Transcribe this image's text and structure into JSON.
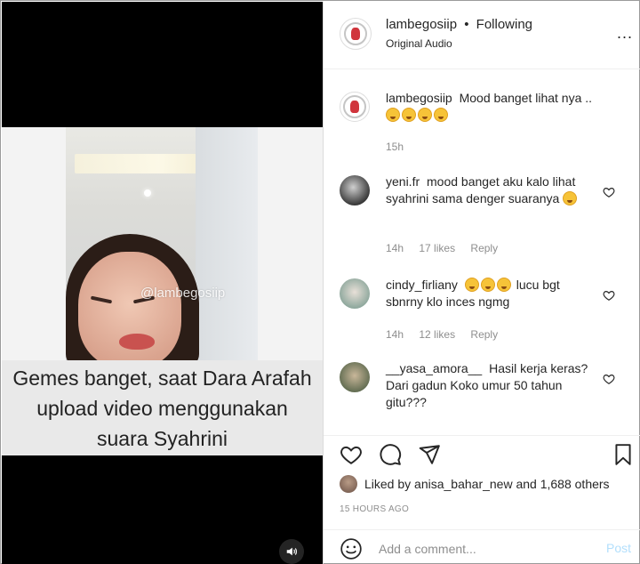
{
  "post": {
    "username": "lambegosiip",
    "dot": "•",
    "follow_status": "Following",
    "audio": "Original Audio",
    "more": "..."
  },
  "video": {
    "watermark": "@lambegosiip",
    "caption": "Gemes banget, saat Dara Arafah upload video menggunakan suara Syahrini",
    "sound_icon": "speaker-icon"
  },
  "caption_comment": {
    "username": "lambegosiip",
    "text": "Mood banget lihat nya ..",
    "emoji_count": 4,
    "time": "15h"
  },
  "comments": [
    {
      "username": "yeni.fr",
      "text": "mood banget aku kalo lihat syahrini sama denger suaranya",
      "emoji_count": 1,
      "time": "14h",
      "likes": "17 likes",
      "reply": "Reply"
    },
    {
      "username": "cindy_firliany",
      "text": "lucu bgt sbnrny klo inces ngmg",
      "emoji_count": 3,
      "time": "14h",
      "likes": "12 likes",
      "reply": "Reply"
    },
    {
      "username": "__yasa_amora__",
      "text": "Hasil kerja keras? Dari gadun Koko umur 50 tahun gitu???",
      "emoji_count": 0
    }
  ],
  "actions": {
    "liked_by_prefix": "Liked by",
    "liked_by_user": "anisa_bahar_new",
    "liked_by_suffix": "and 1,688 others",
    "timestamp": "15 HOURS AGO"
  },
  "add_comment": {
    "placeholder": "Add a comment...",
    "post_label": "Post"
  },
  "colors": {
    "post_button_disabled": "#b2dffc",
    "muted_text": "#8e8e8e",
    "video_bg": "#000000"
  }
}
